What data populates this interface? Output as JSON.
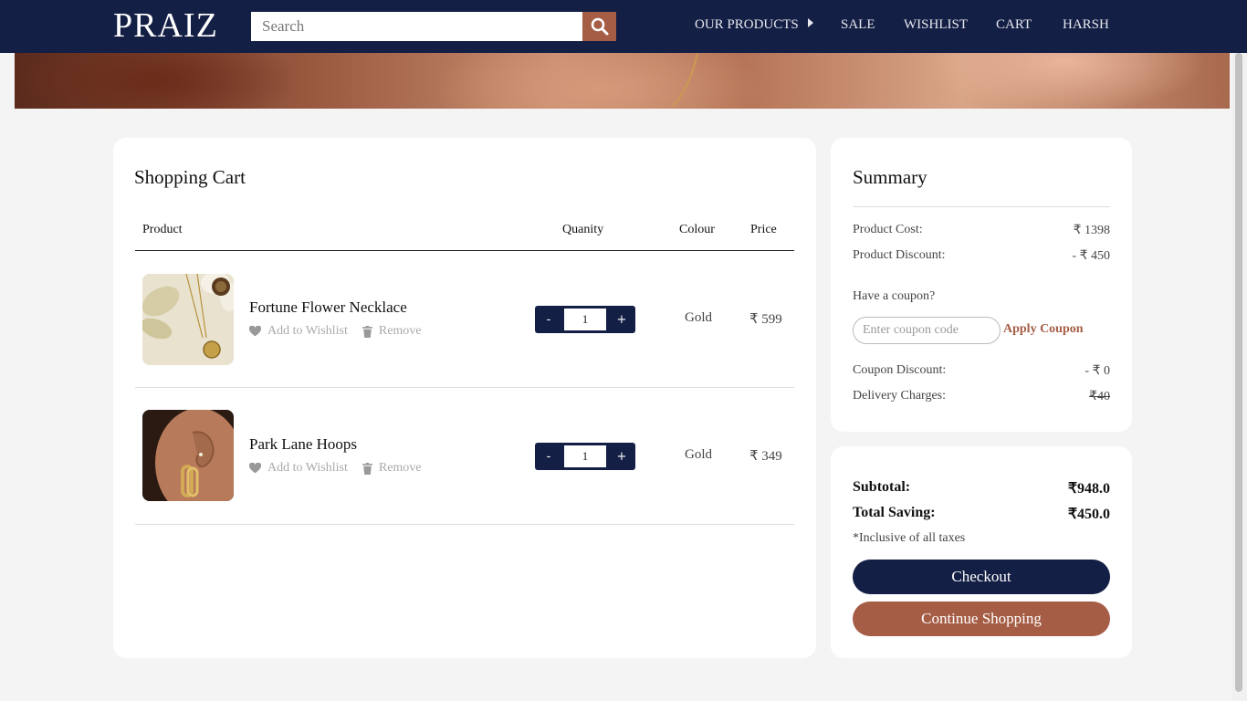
{
  "nav": {
    "logo": "PRAIZ",
    "search_placeholder": "Search",
    "menu": {
      "products": "OUR PRODUCTS",
      "sale": "SALE",
      "wishlist": "WISHLIST",
      "cart": "CART",
      "user": "HARSH"
    }
  },
  "cart": {
    "title": "Shopping Cart",
    "columns": {
      "product": "Product",
      "quantity": "Quanity",
      "colour": "Colour",
      "price": "Price"
    },
    "items": [
      {
        "name": "Fortune Flower Necklace",
        "wishlist": "Add to Wishlist",
        "remove": "Remove",
        "minus": "-",
        "qty": "1",
        "plus": "+",
        "colour": "Gold",
        "price": "₹ 599"
      },
      {
        "name": "Park Lane Hoops",
        "wishlist": "Add to Wishlist",
        "remove": "Remove",
        "minus": "-",
        "qty": "1",
        "plus": "+",
        "colour": "Gold",
        "price": "₹ 349"
      }
    ]
  },
  "summary": {
    "title": "Summary",
    "product_cost_label": "Product Cost:",
    "product_cost": "₹ 1398",
    "product_discount_label": "Product Discount:",
    "product_discount": "- ₹ 450",
    "coupon_label": "Have a coupon?",
    "coupon_placeholder": "Enter coupon code",
    "apply_label": "Apply Coupon",
    "coupon_discount_label": "Coupon Discount:",
    "coupon_discount": "- ₹ 0",
    "delivery_label": "Delivery Charges:",
    "delivery": "₹40"
  },
  "totals": {
    "subtotal_label": "Subtotal:",
    "subtotal": "₹948.0",
    "saving_label": "Total Saving:",
    "saving": "₹450.0",
    "taxes_note": "*Inclusive of all taxes",
    "checkout_label": "Checkout",
    "continue_label": "Continue Shopping"
  }
}
